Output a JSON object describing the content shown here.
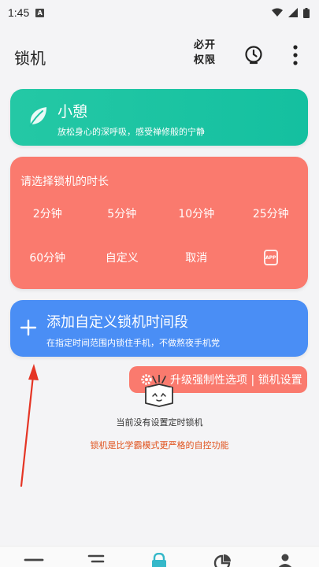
{
  "status_bar": {
    "time": "1:45",
    "notification_icon": "A"
  },
  "app_bar": {
    "title": "锁机",
    "permission_label": "必开权限",
    "clock_icon": "timer-icon",
    "more_icon": "more-vertical-icon"
  },
  "rest_card": {
    "title": "小憩",
    "subtitle": "放松身心的深呼吸，感受禅修般的宁静",
    "icon": "leaf-icon",
    "color": "#1fc5a3"
  },
  "duration_card": {
    "title": "请选择锁机的时长",
    "color": "#fa7a6e",
    "options": [
      "2分钟",
      "5分钟",
      "10分钟",
      "25分钟",
      "60分钟",
      "自定义",
      "取消"
    ],
    "app_icon_label": "APP"
  },
  "add_card": {
    "title": "添加自定义锁机时间段",
    "subtitle": "在指定时间范围内锁住手机，不做熬夜手机党",
    "icon": "plus-icon",
    "color": "#4a8ef5"
  },
  "upgrade_button": {
    "label": "升级强制性选项 | 锁机设置",
    "icon": "gear-icon"
  },
  "empty_state": {
    "message": "当前没有设置定时锁机",
    "note": "锁机是比学霸模式更严格的自控功能"
  },
  "bottom_nav": {
    "items": [
      "menu-icon",
      "list-icon",
      "lock-icon",
      "pie-chart-icon",
      "user-icon"
    ],
    "active_color": "#35b8c9"
  }
}
